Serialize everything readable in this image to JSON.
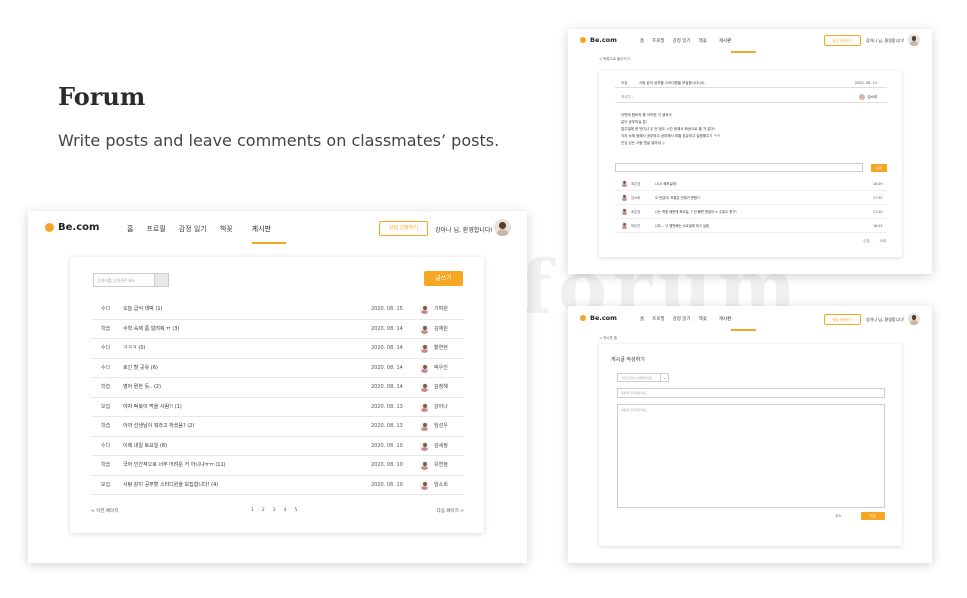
{
  "watermark": "forum",
  "hero": {
    "title": "Forum",
    "subtitle": "Write posts and leave comments on classmates’ posts."
  },
  "nav": {
    "logo": "Be.com",
    "menu": [
      "홈",
      "프로필",
      "감정 일기",
      "책꽂",
      "게시판"
    ],
    "active_index": 4,
    "apply_label": "상담 신청하기",
    "greeting": "강아나 님, 환영합니다!"
  },
  "list": {
    "search_placeholder": "검색어를 입력해주세요",
    "write_label": "글쓰기",
    "rows": [
      {
        "category": "수다",
        "title": "오늘 급식 대박 (1)",
        "date": "2020. 08. 15",
        "author": "기여원"
      },
      {
        "category": "학습",
        "title": "수학 숙제 좀 알려줘 ㅠ (3)",
        "date": "2020. 08. 14",
        "author": "김재원"
      },
      {
        "category": "수다",
        "title": "ㅋㅋㅋ (0)",
        "date": "2020. 08. 14",
        "author": "황연현"
      },
      {
        "category": "수다",
        "title": "로긴 할 곳유 (6)",
        "date": "2020. 08. 14",
        "author": "박우진"
      },
      {
        "category": "학습",
        "title": "영어 뭔한 듯.. (2)",
        "date": "2020. 08. 14",
        "author": "김정혜"
      },
      {
        "category": "모집",
        "title": "야자 떡볶이 먹을 사람!! (1)",
        "date": "2020. 08. 13",
        "author": "강아나"
      },
      {
        "category": "학습",
        "title": "아까 선생님이 뭐라고 하셨음? (2)",
        "date": "2020. 08. 13",
        "author": "임성우"
      },
      {
        "category": "수다",
        "title": "이제 내일 토요일 (8)",
        "date": "2020. 08. 10",
        "author": "김세정"
      },
      {
        "category": "학습",
        "title": "국어 인간적으로 너무 어려운 거 아니냐ㅠㅠ (11)",
        "date": "2020. 08. 10",
        "author": "유연정"
      },
      {
        "category": "모집",
        "title": "사탕 같이 공부할 스터디원을 모집합니다! (4)",
        "date": "2020. 08. 10",
        "author": "임소희"
      }
    ],
    "pager": {
      "prev": "< 이전 페이지",
      "pages": [
        "1",
        "2",
        "3",
        "4",
        "5"
      ],
      "next": "다음 페이지 >"
    }
  },
  "detail": {
    "back": "< 목록으로 돌아가기",
    "category": "모집",
    "title": "사탕 같이 공부할 스터디원을 모집합니다!(4)",
    "date": "2020. 08. 10",
    "author_label": "작성자 :",
    "author": "임소희",
    "body": [
      "이번에 합바지 좀 이따운 거 생겨서",
      "같이 공부하실 분!",
      "일주일에 한 번이나 두 번 정도 시간 정해서 화상으로 할 거 같아!",
      "각자 숙제 정해서 공부하고 공부해서 퍼즐 공유하고 설명해주기 ㅋㅋ",
      "관심 있는 사람 댓글 달아줘 :)"
    ],
    "comment_btn": "등록",
    "comments": [
      {
        "name": "조은영",
        "text": "나나! 해보실래!",
        "time": "18:49"
      },
      {
        "name": "임소희",
        "text": "오 반갑다! 보통은 언제가 편함?!",
        "time": "17:30"
      },
      {
        "name": "조은영",
        "text": "나는 학원 때문에 목요일, 7 안 빼면 괜찮아 ㅠ 주말도 좋구!",
        "time": "17:10"
      },
      {
        "name": "박우진",
        "text": "나도... 난 몇번째는 수요일에 하고 싶음",
        "time": "16:55"
      }
    ],
    "actions": [
      "수정",
      "삭제"
    ]
  },
  "write": {
    "back": "< 게시판 홈",
    "title": "게시글 작성하기",
    "category_placeholder": "카테고리를 선택해주세요",
    "title_placeholder": "제목을 입력해주세요",
    "body_placeholder": "내용을 입력해주세요",
    "cancel": "취소",
    "submit": "작성"
  },
  "colors": {
    "accent": "#f6a623"
  }
}
